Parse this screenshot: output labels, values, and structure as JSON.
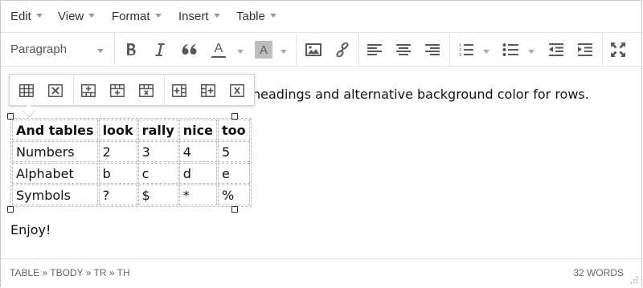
{
  "menubar": {
    "items": [
      {
        "label": "Edit"
      },
      {
        "label": "View"
      },
      {
        "label": "Format"
      },
      {
        "label": "Insert"
      },
      {
        "label": "Table"
      }
    ]
  },
  "toolbar": {
    "format_select": "Paragraph",
    "buttons": [
      {
        "icon": "bold-icon"
      },
      {
        "icon": "italic-icon"
      },
      {
        "icon": "blockquote-icon"
      },
      {
        "icon": "text-color-icon",
        "label": "A"
      },
      {
        "icon": "background-color-icon",
        "label": "A"
      },
      {
        "icon": "image-icon"
      },
      {
        "icon": "link-icon"
      },
      {
        "icon": "align-left-icon"
      },
      {
        "icon": "align-center-icon"
      },
      {
        "icon": "align-right-icon"
      },
      {
        "icon": "numbered-list-icon"
      },
      {
        "icon": "bullet-list-icon"
      },
      {
        "icon": "outdent-icon"
      },
      {
        "icon": "indent-icon"
      },
      {
        "icon": "fullscreen-icon"
      }
    ]
  },
  "content": {
    "paragraph_tail": "headings and alternative background color for rows.",
    "closing": "Enjoy!"
  },
  "table": {
    "headers": [
      "And tables",
      "look",
      "rally",
      "nice",
      "too"
    ],
    "rows": [
      [
        "Numbers",
        "2",
        "3",
        "4",
        "5"
      ],
      [
        "Alphabet",
        "b",
        "c",
        "d",
        "e"
      ],
      [
        "Symbols",
        "?",
        "$",
        "*",
        "%"
      ]
    ]
  },
  "table_context_toolbar": {
    "buttons": [
      {
        "icon": "table-properties-icon"
      },
      {
        "icon": "delete-table-icon"
      },
      {
        "icon": "insert-row-before-icon"
      },
      {
        "icon": "insert-row-after-icon"
      },
      {
        "icon": "delete-row-icon"
      },
      {
        "icon": "insert-column-before-icon"
      },
      {
        "icon": "insert-column-after-icon"
      },
      {
        "icon": "delete-column-icon"
      }
    ]
  },
  "statusbar": {
    "path": "TABLE » TBODY » TR » TH",
    "word_count": "32 WORDS"
  },
  "colors": {
    "border": "#c9c9c9",
    "separator": "#e2e2e2",
    "icon": "#595959",
    "text": "#111111"
  }
}
